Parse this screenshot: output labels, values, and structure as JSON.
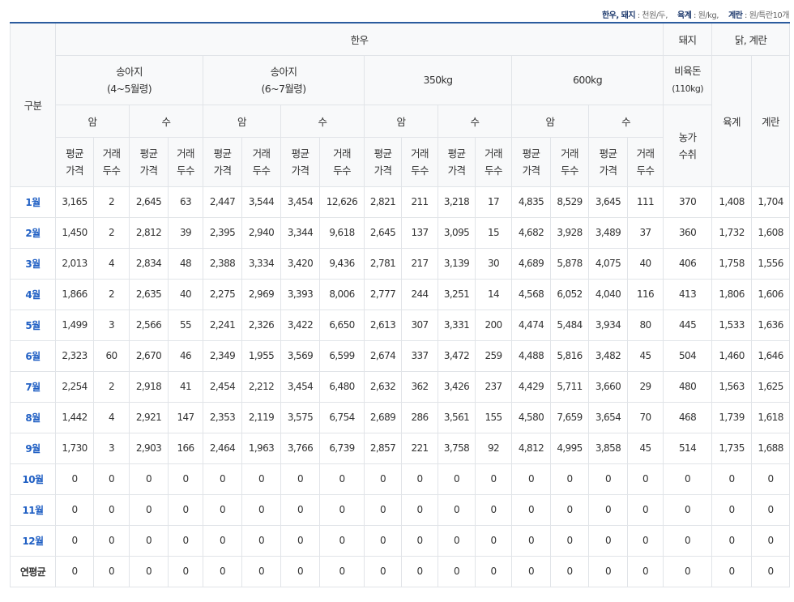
{
  "units": {
    "a_label": "한우, 돼지",
    "a_value": " : 천원/두,",
    "b_label": "육계",
    "b_value": " : 원/kg,",
    "c_label": "계란",
    "c_value": " : 원/특란10개"
  },
  "header": {
    "category": "구분",
    "hanwoo": "한우",
    "pig": "돼지",
    "chicken_egg": "닭, 계란",
    "groups": {
      "calf45_line1": "송아지",
      "calf45_line2": "(4~5월령)",
      "calf67_line1": "송아지",
      "calf67_line2": "(6~7월령)",
      "w350": "350kg",
      "w600": "600kg"
    },
    "pig_sub_line1": "비육돈",
    "pig_sub_line2": "(110kg)",
    "female": "암",
    "male": "수",
    "price_line1": "평균",
    "price_line2": "가격",
    "count_line1": "거래",
    "count_line2": "두수",
    "farm_line1": "농가",
    "farm_line2": "수취",
    "broiler": "육계",
    "egg": "계란"
  },
  "rows": [
    {
      "label": "1월",
      "values": [
        "3,165",
        "2",
        "2,645",
        "63",
        "2,447",
        "3,544",
        "3,454",
        "12,626",
        "2,821",
        "211",
        "3,218",
        "17",
        "4,835",
        "8,529",
        "3,645",
        "111",
        "370",
        "1,408",
        "1,704"
      ]
    },
    {
      "label": "2월",
      "values": [
        "1,450",
        "2",
        "2,812",
        "39",
        "2,395",
        "2,940",
        "3,344",
        "9,618",
        "2,645",
        "137",
        "3,095",
        "15",
        "4,682",
        "3,928",
        "3,489",
        "37",
        "360",
        "1,732",
        "1,608"
      ]
    },
    {
      "label": "3월",
      "values": [
        "2,013",
        "4",
        "2,834",
        "48",
        "2,388",
        "3,334",
        "3,420",
        "9,436",
        "2,781",
        "217",
        "3,139",
        "30",
        "4,689",
        "5,878",
        "4,075",
        "40",
        "406",
        "1,758",
        "1,556"
      ]
    },
    {
      "label": "4월",
      "values": [
        "1,866",
        "2",
        "2,635",
        "40",
        "2,275",
        "2,969",
        "3,393",
        "8,006",
        "2,777",
        "244",
        "3,251",
        "14",
        "4,568",
        "6,052",
        "4,040",
        "116",
        "413",
        "1,806",
        "1,606"
      ]
    },
    {
      "label": "5월",
      "values": [
        "1,499",
        "3",
        "2,566",
        "55",
        "2,241",
        "2,326",
        "3,422",
        "6,650",
        "2,613",
        "307",
        "3,331",
        "200",
        "4,474",
        "5,484",
        "3,934",
        "80",
        "445",
        "1,533",
        "1,636"
      ]
    },
    {
      "label": "6월",
      "values": [
        "2,323",
        "60",
        "2,670",
        "46",
        "2,349",
        "1,955",
        "3,569",
        "6,599",
        "2,674",
        "337",
        "3,472",
        "259",
        "4,488",
        "5,816",
        "3,482",
        "45",
        "504",
        "1,460",
        "1,646"
      ]
    },
    {
      "label": "7월",
      "values": [
        "2,254",
        "2",
        "2,918",
        "41",
        "2,454",
        "2,212",
        "3,454",
        "6,480",
        "2,632",
        "362",
        "3,426",
        "237",
        "4,429",
        "5,711",
        "3,660",
        "29",
        "480",
        "1,563",
        "1,625"
      ]
    },
    {
      "label": "8월",
      "values": [
        "1,442",
        "4",
        "2,921",
        "147",
        "2,353",
        "2,119",
        "3,575",
        "6,754",
        "2,689",
        "286",
        "3,561",
        "155",
        "4,580",
        "7,659",
        "3,654",
        "70",
        "468",
        "1,739",
        "1,618"
      ]
    },
    {
      "label": "9월",
      "values": [
        "1,730",
        "3",
        "2,903",
        "166",
        "2,464",
        "1,963",
        "3,766",
        "6,739",
        "2,857",
        "221",
        "3,758",
        "92",
        "4,812",
        "4,995",
        "3,858",
        "45",
        "514",
        "1,735",
        "1,688"
      ]
    },
    {
      "label": "10월",
      "values": [
        "0",
        "0",
        "0",
        "0",
        "0",
        "0",
        "0",
        "0",
        "0",
        "0",
        "0",
        "0",
        "0",
        "0",
        "0",
        "0",
        "0",
        "0",
        "0"
      ]
    },
    {
      "label": "11월",
      "values": [
        "0",
        "0",
        "0",
        "0",
        "0",
        "0",
        "0",
        "0",
        "0",
        "0",
        "0",
        "0",
        "0",
        "0",
        "0",
        "0",
        "0",
        "0",
        "0"
      ]
    },
    {
      "label": "12월",
      "values": [
        "0",
        "0",
        "0",
        "0",
        "0",
        "0",
        "0",
        "0",
        "0",
        "0",
        "0",
        "0",
        "0",
        "0",
        "0",
        "0",
        "0",
        "0",
        "0"
      ]
    },
    {
      "label": "연평균",
      "values": [
        "0",
        "0",
        "0",
        "0",
        "0",
        "0",
        "0",
        "0",
        "0",
        "0",
        "0",
        "0",
        "0",
        "0",
        "0",
        "0",
        "0",
        "0",
        "0"
      ]
    }
  ]
}
